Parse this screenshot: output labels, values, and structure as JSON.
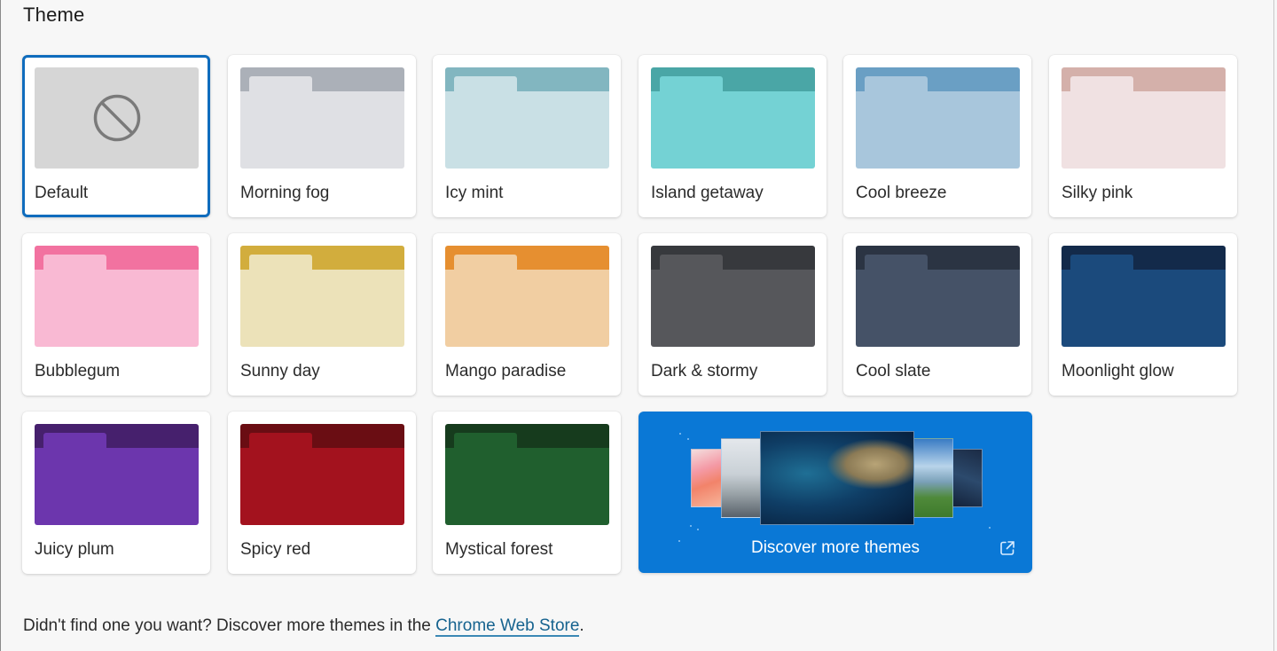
{
  "section": {
    "title": "Theme"
  },
  "themes": [
    {
      "label": "Default",
      "selected": true,
      "icon": "no-theme-icon",
      "colors": {
        "base": "#d6d6d6"
      }
    },
    {
      "label": "Morning fog",
      "selected": false,
      "colors": {
        "strip": "#abb0b8",
        "body": "#dfe0e4"
      }
    },
    {
      "label": "Icy mint",
      "selected": false,
      "colors": {
        "strip": "#82b6c0",
        "body": "#c9e0e5"
      }
    },
    {
      "label": "Island getaway",
      "selected": false,
      "colors": {
        "strip": "#4aa6a6",
        "body": "#74d2d4"
      }
    },
    {
      "label": "Cool breeze",
      "selected": false,
      "colors": {
        "strip": "#6a9fc4",
        "body": "#a8c6dc"
      }
    },
    {
      "label": "Silky pink",
      "selected": false,
      "colors": {
        "strip": "#d4b0aa",
        "body": "#f0e1e2"
      }
    },
    {
      "label": "Bubblegum",
      "selected": false,
      "colors": {
        "strip": "#f272a0",
        "body": "#f9b9d3"
      }
    },
    {
      "label": "Sunny day",
      "selected": false,
      "colors": {
        "strip": "#d2ad3d",
        "body": "#ece2b9"
      }
    },
    {
      "label": "Mango paradise",
      "selected": false,
      "colors": {
        "strip": "#e68f30",
        "body": "#f1cea2"
      }
    },
    {
      "label": "Dark & stormy",
      "selected": false,
      "colors": {
        "strip": "#37393d",
        "body": "#56575b"
      }
    },
    {
      "label": "Cool slate",
      "selected": false,
      "colors": {
        "strip": "#2b3443",
        "body": "#455267"
      }
    },
    {
      "label": "Moonlight glow",
      "selected": false,
      "colors": {
        "strip": "#132a4a",
        "body": "#1b4a7c"
      }
    },
    {
      "label": "Juicy plum",
      "selected": false,
      "colors": {
        "strip": "#46206d",
        "body": "#6c36ad"
      }
    },
    {
      "label": "Spicy red",
      "selected": false,
      "colors": {
        "strip": "#6a0d13",
        "body": "#a3121e"
      }
    },
    {
      "label": "Mystical forest",
      "selected": false,
      "colors": {
        "strip": "#163b1d",
        "body": "#205f2e"
      }
    }
  ],
  "discover": {
    "label": "Discover more themes",
    "icon": "external-link-icon",
    "background": "#0a78d6"
  },
  "footer": {
    "text": "Didn't find one you want? Discover more themes in the ",
    "link_label": "Chrome Web Store",
    "trailing": "."
  },
  "colors": {
    "accent": "#0f6cbd",
    "link": "#16638f"
  }
}
